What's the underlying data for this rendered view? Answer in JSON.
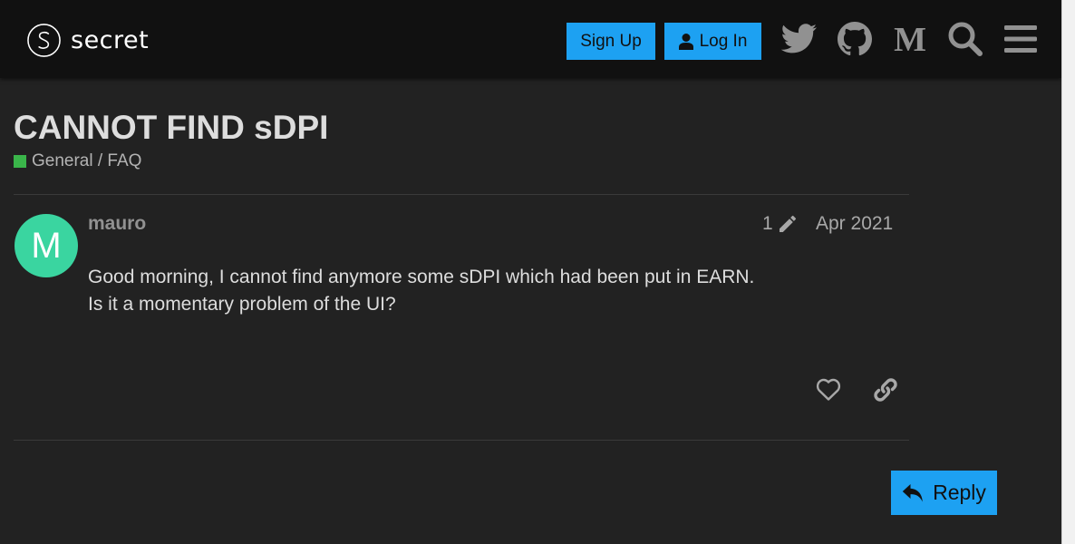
{
  "header": {
    "logo_text": "secret",
    "signup_label": "Sign Up",
    "login_label": "Log In",
    "icons": [
      "twitter-icon",
      "github-icon",
      "medium-icon",
      "search-icon",
      "menu-icon"
    ]
  },
  "topic": {
    "title": "CANNOT FIND sDPI",
    "category": "General / FAQ",
    "category_color": "#3ab54a"
  },
  "post": {
    "avatar_letter": "M",
    "avatar_color": "#3ad5a0",
    "username": "mauro",
    "edit_count": "1",
    "date": "Apr 2021",
    "body_lines": [
      "Good morning, I cannot find anymore some sDPI which had been put in EARN.",
      "Is it a momentary problem of the UI?"
    ]
  },
  "actions": {
    "reply_label": "Reply"
  },
  "colors": {
    "accent": "#1da1f2",
    "background": "#222222",
    "header_bg": "#111111"
  }
}
